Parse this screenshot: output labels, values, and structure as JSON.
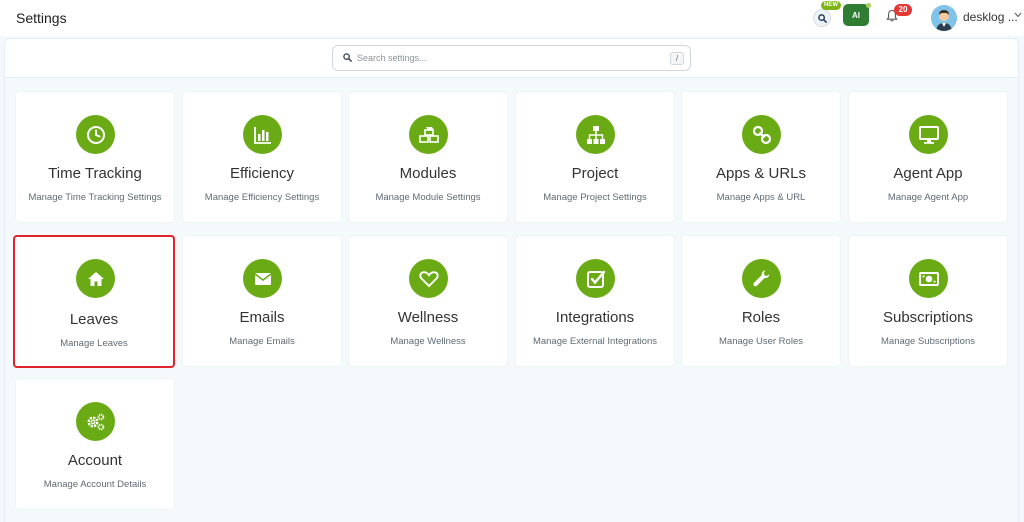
{
  "header": {
    "title": "Settings",
    "new_badge": "NEW",
    "ai_label": "AI",
    "notification_count": "20",
    "user_name": "desklog ..."
  },
  "search": {
    "placeholder": "Search settings...",
    "shortcut": "/"
  },
  "colors": {
    "accent": "#6aab15",
    "selected_border": "#e0242c",
    "notification": "#e53935"
  },
  "cards": [
    {
      "title": "Time Tracking",
      "subtitle": "Manage Time Tracking Settings",
      "icon": "clock-icon"
    },
    {
      "title": "Efficiency",
      "subtitle": "Manage Efficiency Settings",
      "icon": "bar-chart-icon"
    },
    {
      "title": "Modules",
      "subtitle": "Manage Module Settings",
      "icon": "cubes-icon"
    },
    {
      "title": "Project",
      "subtitle": "Manage Project Settings",
      "icon": "sitemap-icon"
    },
    {
      "title": "Apps & URLs",
      "subtitle": "Manage Apps & URL",
      "icon": "link-icon"
    },
    {
      "title": "Agent App",
      "subtitle": "Manage Agent App",
      "icon": "monitor-icon"
    },
    {
      "title": "Leaves",
      "subtitle": "Manage Leaves",
      "icon": "home-icon",
      "selected": true
    },
    {
      "title": "Emails",
      "subtitle": "Manage Emails",
      "icon": "envelope-icon"
    },
    {
      "title": "Wellness",
      "subtitle": "Manage Wellness",
      "icon": "heart-icon"
    },
    {
      "title": "Integrations",
      "subtitle": "Manage External Integrations",
      "icon": "check-square-icon"
    },
    {
      "title": "Roles",
      "subtitle": "Manage User Roles",
      "icon": "wrench-icon"
    },
    {
      "title": "Subscriptions",
      "subtitle": "Manage Subscriptions",
      "icon": "money-icon"
    },
    {
      "title": "Account",
      "subtitle": "Manage Account Details",
      "icon": "gears-icon"
    }
  ]
}
